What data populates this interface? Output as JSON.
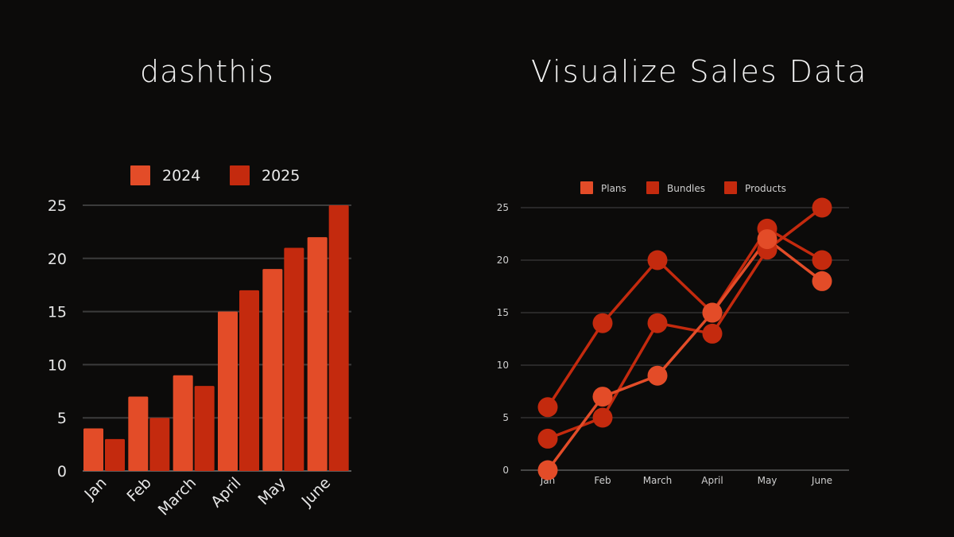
{
  "titles": {
    "left": "dashthis",
    "right": "Visualize Sales Data"
  },
  "chart_data": [
    {
      "type": "bar",
      "title": "",
      "categories": [
        "Jan",
        "Feb",
        "March",
        "April",
        "May",
        "June"
      ],
      "series": [
        {
          "name": "2024",
          "color": "#E34C28",
          "values": [
            4,
            7,
            9,
            15,
            19,
            22
          ]
        },
        {
          "name": "2025",
          "color": "#C42A0E",
          "values": [
            3,
            5,
            8,
            17,
            21,
            25
          ]
        }
      ],
      "xlabel": "",
      "ylabel": "",
      "ylim": [
        0,
        25
      ],
      "yticks": [
        0,
        5,
        10,
        15,
        20,
        25
      ],
      "grid": true,
      "legend_position": "top-center",
      "xtick_rotation": "diagonal"
    },
    {
      "type": "line",
      "title": "",
      "categories": [
        "Jan",
        "Feb",
        "March",
        "April",
        "May",
        "June"
      ],
      "series": [
        {
          "name": "Plans",
          "color": "#E34C28",
          "values": [
            0,
            7,
            9,
            15,
            22,
            18
          ]
        },
        {
          "name": "Bundles",
          "color": "#C42A0E",
          "values": [
            3,
            5,
            14,
            13,
            21,
            25
          ]
        },
        {
          "name": "Products",
          "color": "#C42A0E",
          "values": [
            6,
            14,
            20,
            15,
            23,
            20
          ]
        }
      ],
      "xlabel": "",
      "ylabel": "",
      "ylim": [
        0,
        25
      ],
      "yticks": [
        0,
        5,
        10,
        15,
        20,
        25
      ],
      "grid": true,
      "markers": "circle",
      "legend_position": "top-center"
    }
  ]
}
